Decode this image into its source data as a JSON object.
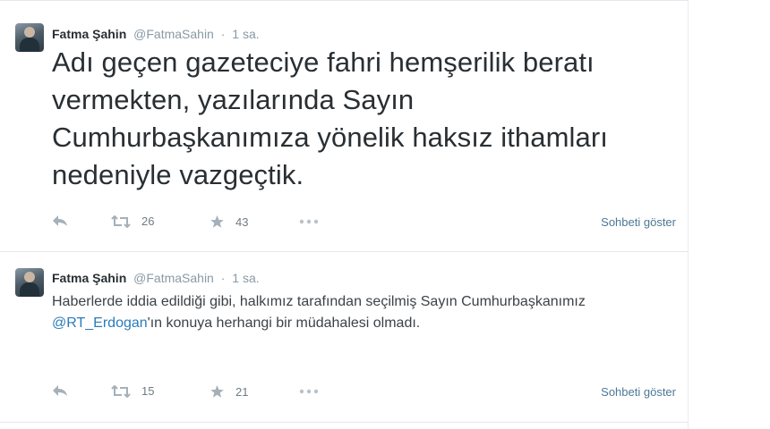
{
  "tweets": [
    {
      "author_name": "Fatma Şahin",
      "handle": "@FatmaSahin",
      "separator": "·",
      "time": "1 sa.",
      "text": "Adı geçen gazeteciye fahri hemşerilik beratı vermekten, yazılarında Sayın Cumhurbaşkanımıza yönelik haksız ithamları nedeniyle vazgeçtik.",
      "retweets": "26",
      "favorites": "43",
      "conversation_label": "Sohbeti göster"
    },
    {
      "author_name": "Fatma Şahin",
      "handle": "@FatmaSahin",
      "separator": "·",
      "time": "1 sa.",
      "text_before": "Haberlerde iddia edildiği gibi, halkımız tarafından seçilmiş Sayın Cumhurbaşkanımız ",
      "mention": "@RT_Erdogan",
      "text_after": "'ın konuya herhangi bir müdahalesi olmadı.",
      "retweets": "15",
      "favorites": "21",
      "conversation_label": "Sohbeti göster"
    }
  ],
  "colors": {
    "name": "#292f33",
    "meta": "#8899a6",
    "mention": "#2b7bb9",
    "action_icon": "#a5b0b8",
    "conversation_link": "#4d7896"
  },
  "icons": [
    "reply-icon",
    "retweet-icon",
    "favorite-star-icon",
    "more-options-icon"
  ]
}
